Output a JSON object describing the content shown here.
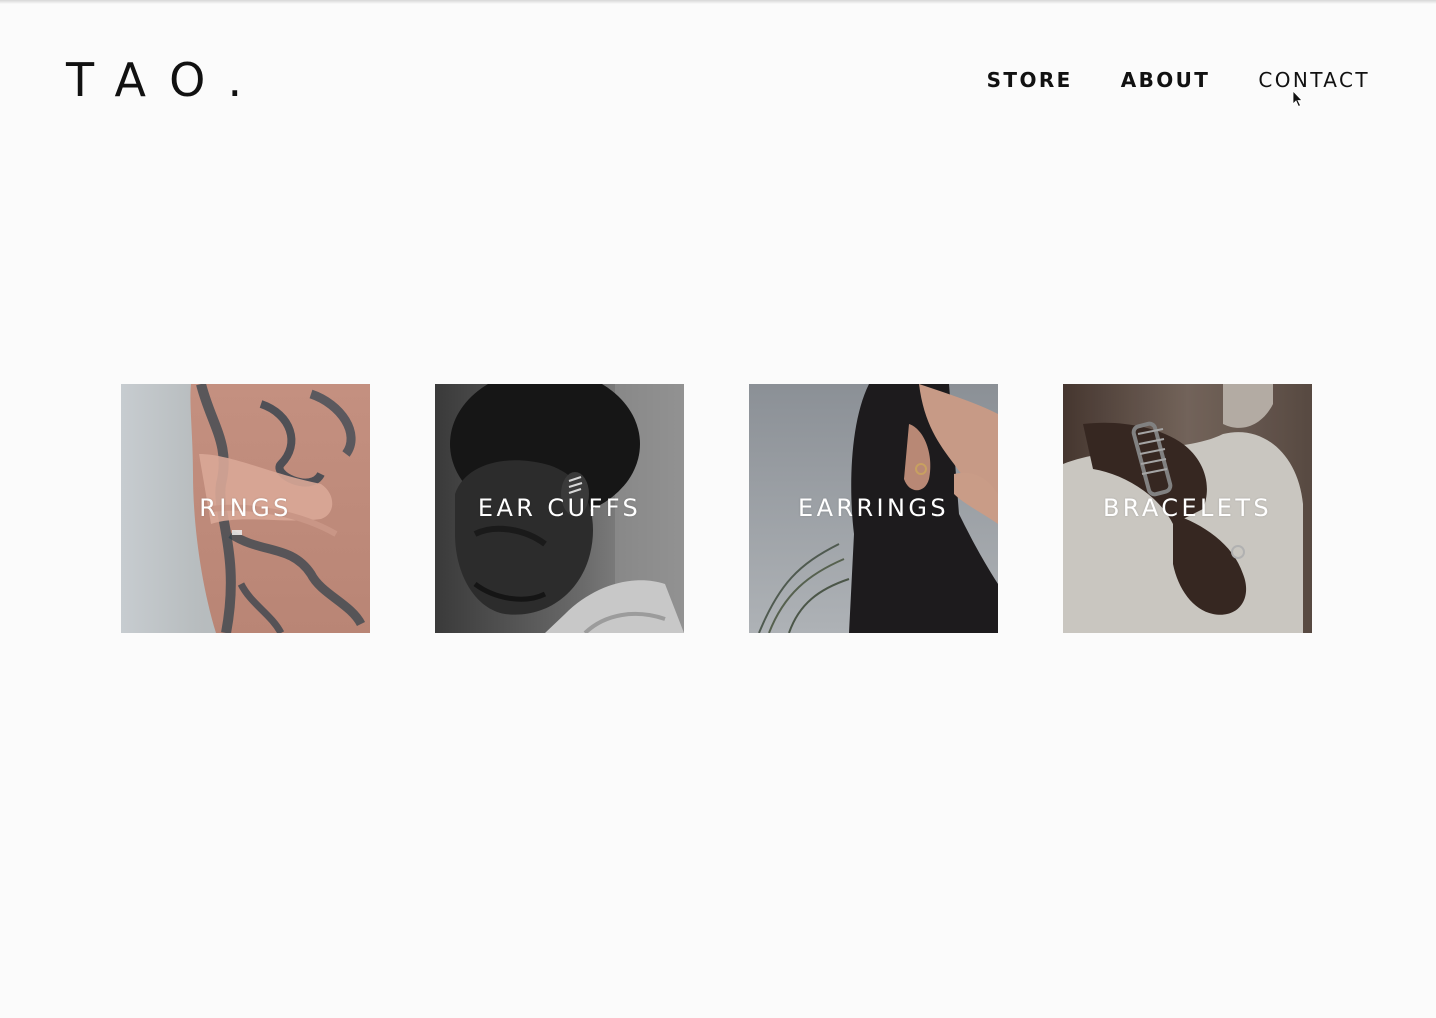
{
  "brand": {
    "logo_text": "TAO."
  },
  "nav": {
    "items": [
      {
        "label": "STORE"
      },
      {
        "label": "ABOUT"
      },
      {
        "label": "CONTACT"
      }
    ]
  },
  "categories": [
    {
      "label": "RINGS"
    },
    {
      "label": "EAR CUFFS"
    },
    {
      "label": "EARRINGS"
    },
    {
      "label": "BRACELETS"
    }
  ],
  "colors": {
    "background": "#fbfbfb",
    "text": "#111111",
    "tile_label": "#ffffff"
  }
}
